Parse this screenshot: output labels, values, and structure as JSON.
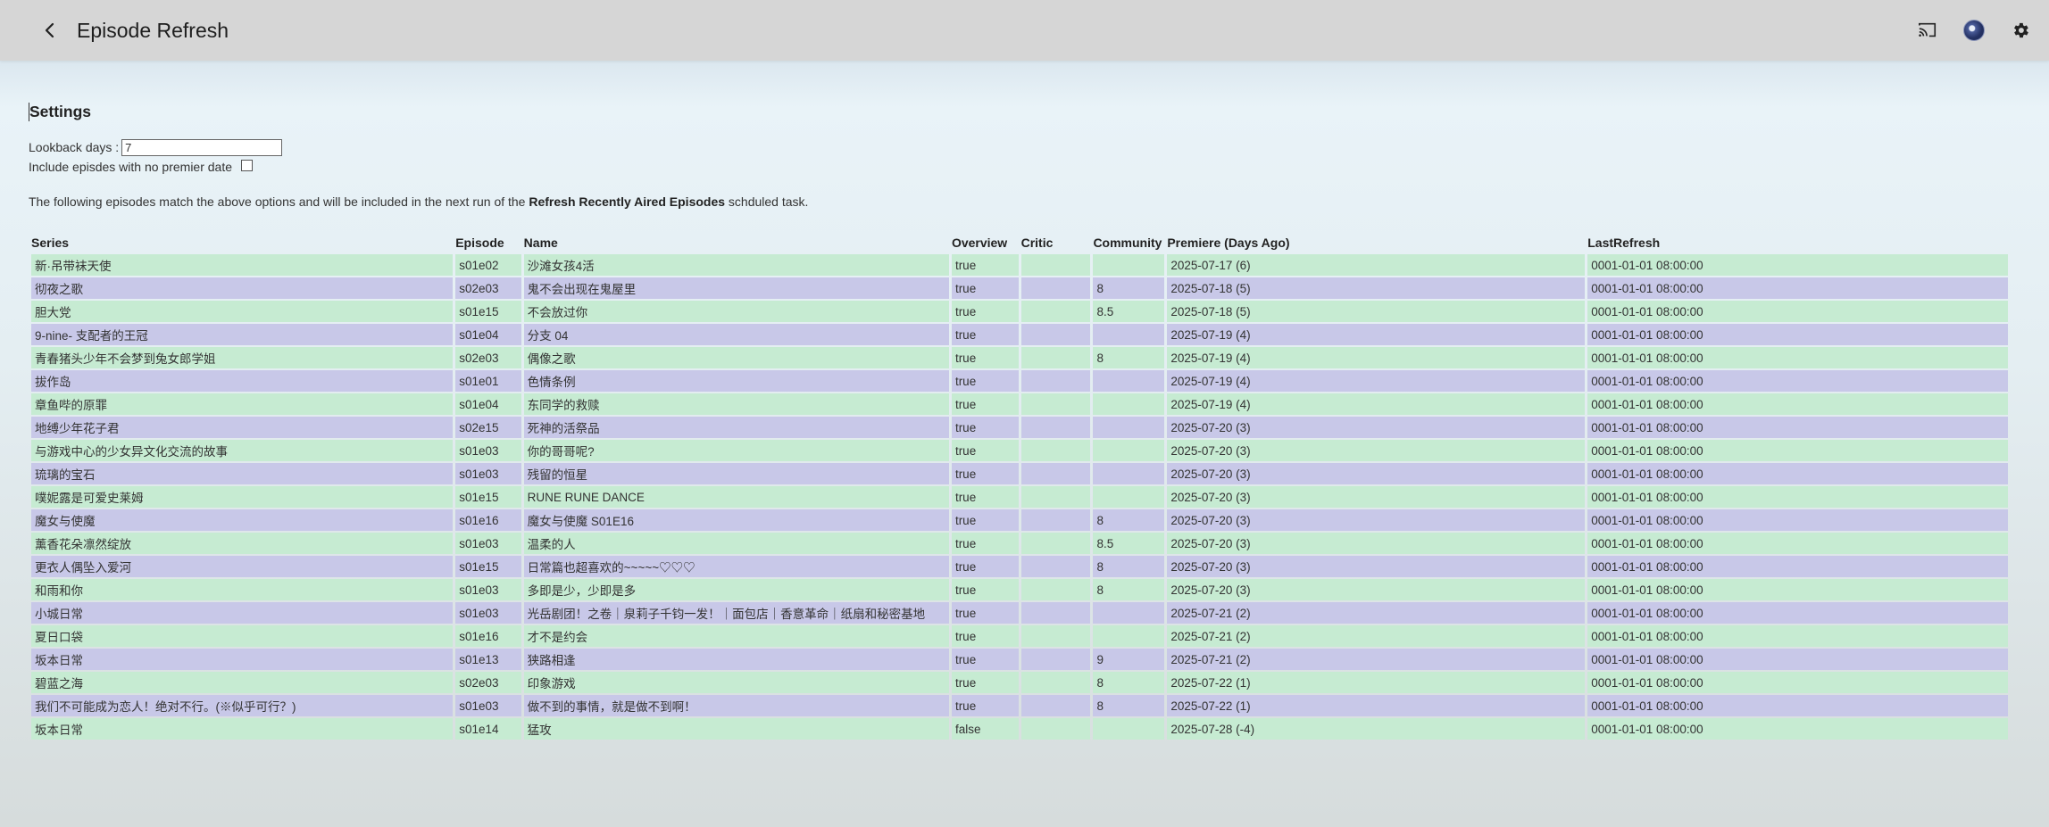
{
  "header": {
    "title": "Episode Refresh"
  },
  "settings": {
    "title": "Settings",
    "lookback_label": "Lookback days :",
    "lookback_value": "7",
    "include_label": "Include episdes with no premier date"
  },
  "info": {
    "prefix": "The following episodes match the above options and will be included in the next run of the ",
    "task": "Refresh Recently Aired Episodes",
    "suffix": " schduled task."
  },
  "table": {
    "headers": [
      "Series",
      "Episode",
      "Name",
      "Overview",
      "Critic",
      "Community",
      "Premiere (Days Ago)",
      "LastRefresh"
    ],
    "rows": [
      [
        "新·吊带袜天使",
        "s01e02",
        "沙滩女孩4活",
        "true",
        "",
        "",
        "2025-07-17 (6)",
        "0001-01-01 08:00:00"
      ],
      [
        "彻夜之歌",
        "s02e03",
        "鬼不会出现在鬼屋里",
        "true",
        "",
        "8",
        "2025-07-18 (5)",
        "0001-01-01 08:00:00"
      ],
      [
        "胆大党",
        "s01e15",
        "不会放过你",
        "true",
        "",
        "8.5",
        "2025-07-18 (5)",
        "0001-01-01 08:00:00"
      ],
      [
        "9-nine- 支配者的王冠",
        "s01e04",
        "分支 04",
        "true",
        "",
        "",
        "2025-07-19 (4)",
        "0001-01-01 08:00:00"
      ],
      [
        "青春猪头少年不会梦到兔女郎学姐",
        "s02e03",
        "偶像之歌",
        "true",
        "",
        "8",
        "2025-07-19 (4)",
        "0001-01-01 08:00:00"
      ],
      [
        "拔作岛",
        "s01e01",
        "色情条例",
        "true",
        "",
        "",
        "2025-07-19 (4)",
        "0001-01-01 08:00:00"
      ],
      [
        "章鱼哔的原罪",
        "s01e04",
        "东同学的救赎",
        "true",
        "",
        "",
        "2025-07-19 (4)",
        "0001-01-01 08:00:00"
      ],
      [
        "地缚少年花子君",
        "s02e15",
        "死神的活祭品",
        "true",
        "",
        "",
        "2025-07-20 (3)",
        "0001-01-01 08:00:00"
      ],
      [
        "与游戏中心的少女异文化交流的故事",
        "s01e03",
        "你的哥哥呢?",
        "true",
        "",
        "",
        "2025-07-20 (3)",
        "0001-01-01 08:00:00"
      ],
      [
        "琉璃的宝石",
        "s01e03",
        "残留的恒星",
        "true",
        "",
        "",
        "2025-07-20 (3)",
        "0001-01-01 08:00:00"
      ],
      [
        "噗妮露是可爱史莱姆",
        "s01e15",
        "RUNE RUNE DANCE",
        "true",
        "",
        "",
        "2025-07-20 (3)",
        "0001-01-01 08:00:00"
      ],
      [
        "魔女与使魔",
        "s01e16",
        "魔女与使魔 S01E16",
        "true",
        "",
        "8",
        "2025-07-20 (3)",
        "0001-01-01 08:00:00"
      ],
      [
        "薰香花朵凛然绽放",
        "s01e03",
        "温柔的人",
        "true",
        "",
        "8.5",
        "2025-07-20 (3)",
        "0001-01-01 08:00:00"
      ],
      [
        "更衣人偶坠入爱河",
        "s01e15",
        "日常篇也超喜欢的~~~~~♡♡♡",
        "true",
        "",
        "8",
        "2025-07-20 (3)",
        "0001-01-01 08:00:00"
      ],
      [
        "和雨和你",
        "s01e03",
        "多即是少，少即是多",
        "true",
        "",
        "8",
        "2025-07-20 (3)",
        "0001-01-01 08:00:00"
      ],
      [
        "小城日常",
        "s01e03",
        "光岳剧团！之卷｜泉莉子千钧一发！｜面包店｜香意革命｜纸扇和秘密基地",
        "true",
        "",
        "",
        "2025-07-21 (2)",
        "0001-01-01 08:00:00"
      ],
      [
        "夏日口袋",
        "s01e16",
        "才不是约会",
        "true",
        "",
        "",
        "2025-07-21 (2)",
        "0001-01-01 08:00:00"
      ],
      [
        "坂本日常",
        "s01e13",
        "狭路相逢",
        "true",
        "",
        "9",
        "2025-07-21 (2)",
        "0001-01-01 08:00:00"
      ],
      [
        "碧蓝之海",
        "s02e03",
        "印象游戏",
        "true",
        "",
        "8",
        "2025-07-22 (1)",
        "0001-01-01 08:00:00"
      ],
      [
        "我们不可能成为恋人！绝对不行。(※似乎可行？)",
        "s01e03",
        "做不到的事情，就是做不到啊！",
        "true",
        "",
        "8",
        "2025-07-22 (1)",
        "0001-01-01 08:00:00"
      ],
      [
        "坂本日常",
        "s01e14",
        "猛攻",
        "false",
        "",
        "",
        "2025-07-28 (-4)",
        "0001-01-01 08:00:00"
      ]
    ]
  },
  "colors": {
    "row_even": "#c6ebd2",
    "row_odd": "#c8c8e8",
    "header_bg": "#d6d6d6"
  },
  "icons": [
    "chevron-left-icon",
    "cast-icon",
    "avatar",
    "gear-icon"
  ]
}
